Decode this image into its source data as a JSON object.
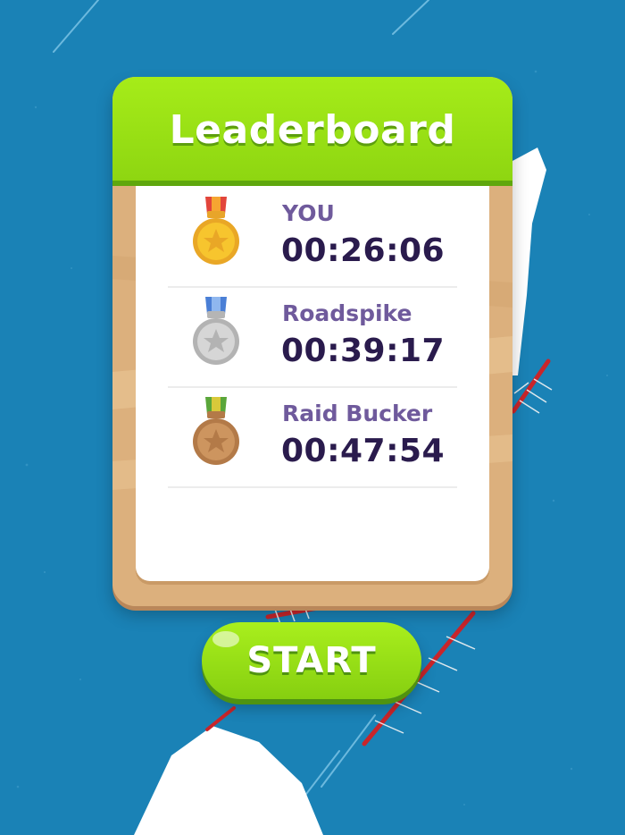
{
  "leaderboard": {
    "title": "Leaderboard",
    "entries": [
      {
        "name": "YOU",
        "time": "00:26:06",
        "medal": "gold-medal-icon"
      },
      {
        "name": "Roadspike",
        "time": "00:39:17",
        "medal": "silver-medal-icon"
      },
      {
        "name": "Raid Bucker",
        "time": "00:47:54",
        "medal": "bronze-medal-icon"
      }
    ]
  },
  "start_button": {
    "label": "START"
  },
  "colors": {
    "water": "#1a82b6",
    "header_green": "#98dd14",
    "name_purple": "#6f5a9c",
    "time_dark": "#2a1b4d",
    "wood": "#dcb07d",
    "gold": "#f7c02a",
    "silver": "#c8c8c8",
    "bronze": "#c48a55"
  }
}
